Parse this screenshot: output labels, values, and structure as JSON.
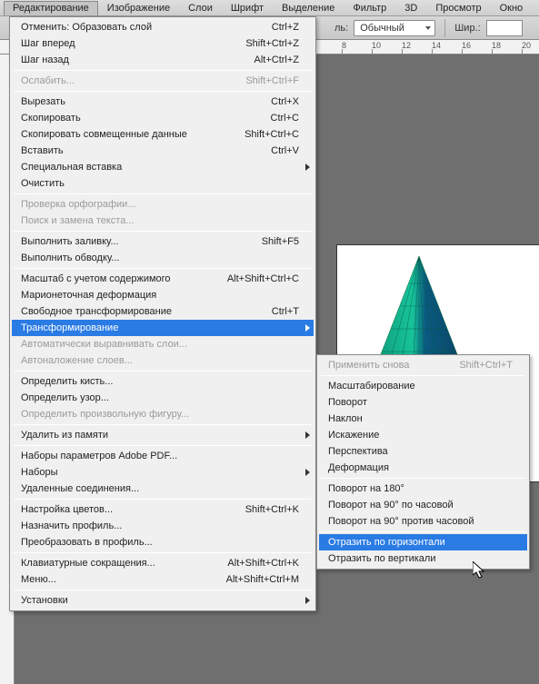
{
  "menubar": {
    "items": [
      "Редактирование",
      "Изображение",
      "Слои",
      "Шрифт",
      "Выделение",
      "Фильтр",
      "3D",
      "Просмотр",
      "Окно"
    ],
    "active_index": 0
  },
  "toolbar": {
    "style_label": "ль:",
    "style_value": "Обычный",
    "width_label": "Шир.:",
    "width_value": ""
  },
  "ruler": {
    "ticks": [
      "8",
      "10",
      "12",
      "14",
      "16",
      "18",
      "20"
    ]
  },
  "edit_menu": {
    "groups": [
      [
        {
          "label": "Отменить: Образовать слой",
          "shortcut": "Ctrl+Z",
          "enabled": true
        },
        {
          "label": "Шаг вперед",
          "shortcut": "Shift+Ctrl+Z",
          "enabled": true
        },
        {
          "label": "Шаг назад",
          "shortcut": "Alt+Ctrl+Z",
          "enabled": true
        }
      ],
      [
        {
          "label": "Ослабить...",
          "shortcut": "Shift+Ctrl+F",
          "enabled": false
        }
      ],
      [
        {
          "label": "Вырезать",
          "shortcut": "Ctrl+X",
          "enabled": true
        },
        {
          "label": "Скопировать",
          "shortcut": "Ctrl+C",
          "enabled": true
        },
        {
          "label": "Скопировать совмещенные данные",
          "shortcut": "Shift+Ctrl+C",
          "enabled": true
        },
        {
          "label": "Вставить",
          "shortcut": "Ctrl+V",
          "enabled": true
        },
        {
          "label": "Специальная вставка",
          "shortcut": "",
          "enabled": true,
          "submenu": true
        },
        {
          "label": "Очистить",
          "shortcut": "",
          "enabled": true
        }
      ],
      [
        {
          "label": "Проверка орфографии...",
          "shortcut": "",
          "enabled": false
        },
        {
          "label": "Поиск и замена текста...",
          "shortcut": "",
          "enabled": false
        }
      ],
      [
        {
          "label": "Выполнить заливку...",
          "shortcut": "Shift+F5",
          "enabled": true
        },
        {
          "label": "Выполнить обводку...",
          "shortcut": "",
          "enabled": true
        }
      ],
      [
        {
          "label": "Масштаб с учетом содержимого",
          "shortcut": "Alt+Shift+Ctrl+C",
          "enabled": true
        },
        {
          "label": "Марионеточная деформация",
          "shortcut": "",
          "enabled": true
        },
        {
          "label": "Свободное трансформирование",
          "shortcut": "Ctrl+T",
          "enabled": true
        },
        {
          "label": "Трансформирование",
          "shortcut": "",
          "enabled": true,
          "submenu": true,
          "highlight": true
        },
        {
          "label": "Автоматически выравнивать слои...",
          "shortcut": "",
          "enabled": false
        },
        {
          "label": "Автоналожение слоев...",
          "shortcut": "",
          "enabled": false
        }
      ],
      [
        {
          "label": "Определить кисть...",
          "shortcut": "",
          "enabled": true
        },
        {
          "label": "Определить узор...",
          "shortcut": "",
          "enabled": true
        },
        {
          "label": "Определить произвольную фигуру...",
          "shortcut": "",
          "enabled": false
        }
      ],
      [
        {
          "label": "Удалить из памяти",
          "shortcut": "",
          "enabled": true,
          "submenu": true
        }
      ],
      [
        {
          "label": "Наборы параметров Adobe PDF...",
          "shortcut": "",
          "enabled": true
        },
        {
          "label": "Наборы",
          "shortcut": "",
          "enabled": true,
          "submenu": true
        },
        {
          "label": "Удаленные соединения...",
          "shortcut": "",
          "enabled": true
        }
      ],
      [
        {
          "label": "Настройка цветов...",
          "shortcut": "Shift+Ctrl+K",
          "enabled": true
        },
        {
          "label": "Назначить профиль...",
          "shortcut": "",
          "enabled": true
        },
        {
          "label": "Преобразовать в профиль...",
          "shortcut": "",
          "enabled": true
        }
      ],
      [
        {
          "label": "Клавиатурные сокращения...",
          "shortcut": "Alt+Shift+Ctrl+K",
          "enabled": true
        },
        {
          "label": "Меню...",
          "shortcut": "Alt+Shift+Ctrl+M",
          "enabled": true
        }
      ],
      [
        {
          "label": "Установки",
          "shortcut": "",
          "enabled": true,
          "submenu": true
        }
      ]
    ]
  },
  "transform_submenu": {
    "groups": [
      [
        {
          "label": "Применить снова",
          "shortcut": "Shift+Ctrl+T",
          "enabled": false
        }
      ],
      [
        {
          "label": "Масштабирование",
          "enabled": true
        },
        {
          "label": "Поворот",
          "enabled": true
        },
        {
          "label": "Наклон",
          "enabled": true
        },
        {
          "label": "Искажение",
          "enabled": true
        },
        {
          "label": "Перспектива",
          "enabled": true
        },
        {
          "label": "Деформация",
          "enabled": true
        }
      ],
      [
        {
          "label": "Поворот на 180°",
          "enabled": true
        },
        {
          "label": "Поворот на 90° по часовой",
          "enabled": true
        },
        {
          "label": "Поворот на 90° против часовой",
          "enabled": true
        }
      ],
      [
        {
          "label": "Отразить по горизонтали",
          "enabled": true,
          "highlight": true
        },
        {
          "label": "Отразить по вертикали",
          "enabled": true
        }
      ]
    ]
  }
}
